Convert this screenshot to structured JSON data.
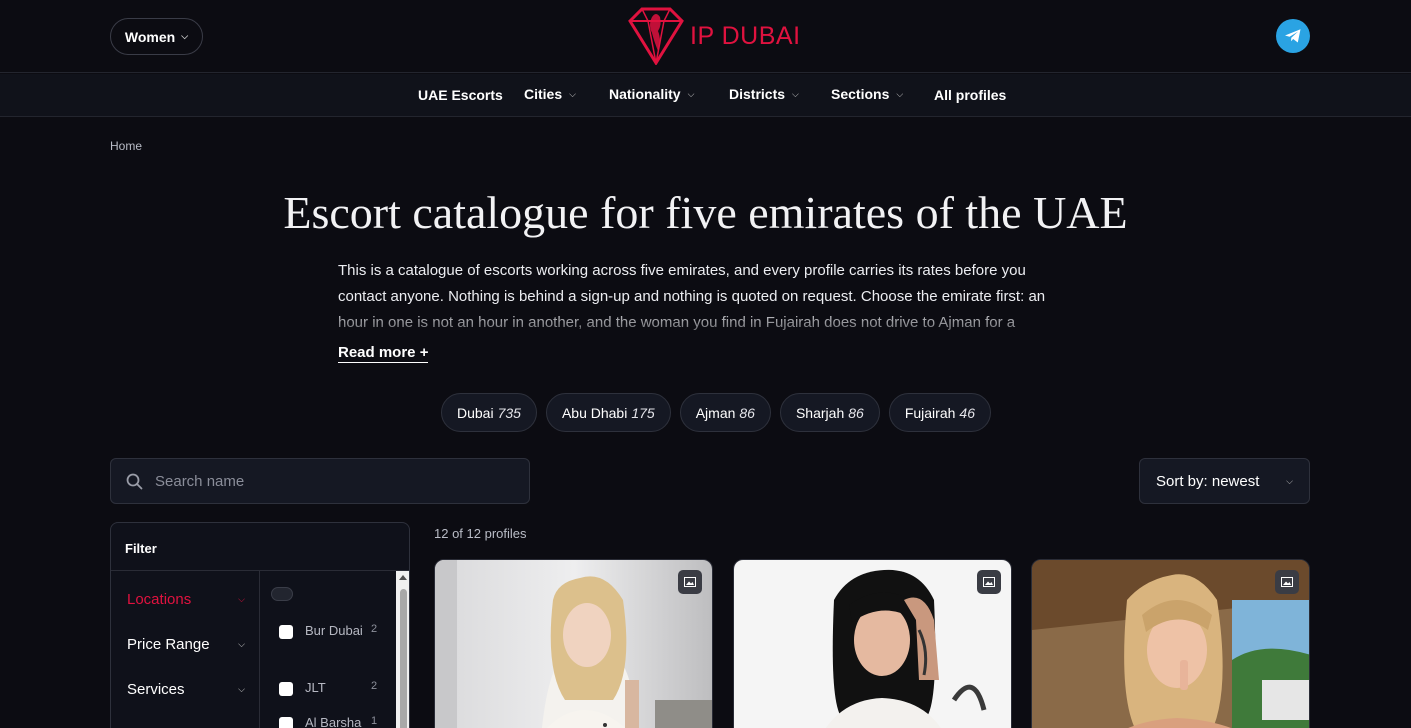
{
  "header": {
    "gender_label": "Women",
    "logo_text": "IP DUBAI",
    "telegram_icon": "telegram-icon"
  },
  "nav": {
    "items": [
      {
        "label": "UAE Escorts",
        "has_dropdown": false
      },
      {
        "label": "Cities",
        "has_dropdown": true
      },
      {
        "label": "Nationality",
        "has_dropdown": true
      },
      {
        "label": "Districts",
        "has_dropdown": true
      },
      {
        "label": "Sections",
        "has_dropdown": true
      },
      {
        "label": "All profiles",
        "has_dropdown": false
      }
    ]
  },
  "breadcrumb": "Home",
  "page": {
    "title": "Escort catalogue for five emirates of the UAE",
    "intro": "This is a catalogue of escorts working across five emirates, and every profile carries its rates before you contact anyone. Nothing is behind a sign-up and nothing is quoted on request. Choose the emirate first: an hour in one is not an hour in another, and the woman you find in Fujairah does not drive to Ajman for a",
    "read_more": "Read more +"
  },
  "cities": [
    {
      "name": "Dubai",
      "count": "735"
    },
    {
      "name": "Abu Dhabi",
      "count": "175"
    },
    {
      "name": "Ajman",
      "count": "86"
    },
    {
      "name": "Sharjah",
      "count": "86"
    },
    {
      "name": "Fujairah",
      "count": "46"
    }
  ],
  "search": {
    "placeholder": "Search name",
    "value": ""
  },
  "sort": {
    "label": "Sort by: newest"
  },
  "filter": {
    "title": "Filter",
    "categories": [
      {
        "label": "Locations",
        "active": true
      },
      {
        "label": "Price Range",
        "active": false
      },
      {
        "label": "Services",
        "active": false
      }
    ],
    "locations": [
      {
        "name": "Bur Dubai",
        "count": "2"
      },
      {
        "name": "JLT",
        "count": "2"
      },
      {
        "name": "Al Barsha",
        "count": "1"
      }
    ]
  },
  "results": {
    "count_text": "12 of 12 profiles"
  },
  "colors": {
    "accent": "#e0123f",
    "background": "#0c0c12",
    "telegram": "#2aa3e3"
  },
  "profiles": [
    {
      "photo": "blonde-woman-white-dress-photo",
      "badge_icon": "image-icon"
    },
    {
      "photo": "dark-haired-woman-white-background-photo",
      "badge_icon": "image-icon"
    },
    {
      "photo": "blonde-woman-tropical-photo",
      "badge_icon": "image-icon"
    }
  ]
}
